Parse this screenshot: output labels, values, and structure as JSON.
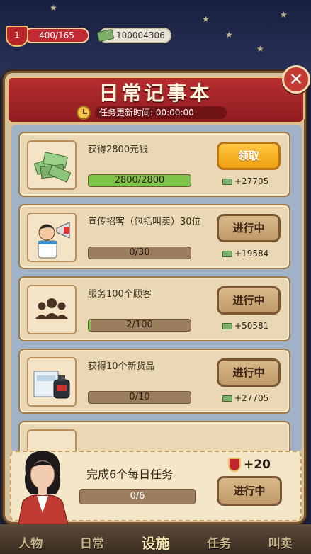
{
  "status_bar": {
    "level": "1",
    "hp_text": "400/165",
    "money": "100004306"
  },
  "modal": {
    "title": "日常记事本",
    "timer_label": "任务更新时间: 00:00:00",
    "close_icon": "close-icon"
  },
  "tasks": [
    {
      "text": "获得2800元钱",
      "progress_label": "2800/2800",
      "progress": 1.0,
      "button_label": "领取",
      "reward": "+27705",
      "state": "claim"
    },
    {
      "text": "宣传招客（包括叫卖）30位",
      "progress_label": "0/30",
      "progress": 0.0,
      "button_label": "进行中",
      "reward": "+19584",
      "state": "in_progress"
    },
    {
      "text": "服务100个顾客",
      "progress_label": "2/100",
      "progress": 0.02,
      "button_label": "进行中",
      "reward": "+50581",
      "state": "in_progress"
    },
    {
      "text": "获得10个新货品",
      "progress_label": "0/10",
      "progress": 0.0,
      "button_label": "进行中",
      "reward": "+27705",
      "state": "in_progress"
    }
  ],
  "summary": {
    "text": "完成6个每日任务",
    "progress_label": "0/6",
    "reward": "+20",
    "button_label": "进行中"
  },
  "bottom_nav": [
    "人物",
    "日常",
    "设施",
    "任务",
    "叫卖"
  ],
  "colors": {
    "banner_red": "#b72e2f",
    "claim_orange": "#f0a010",
    "progress_green": "#7fc24a"
  }
}
